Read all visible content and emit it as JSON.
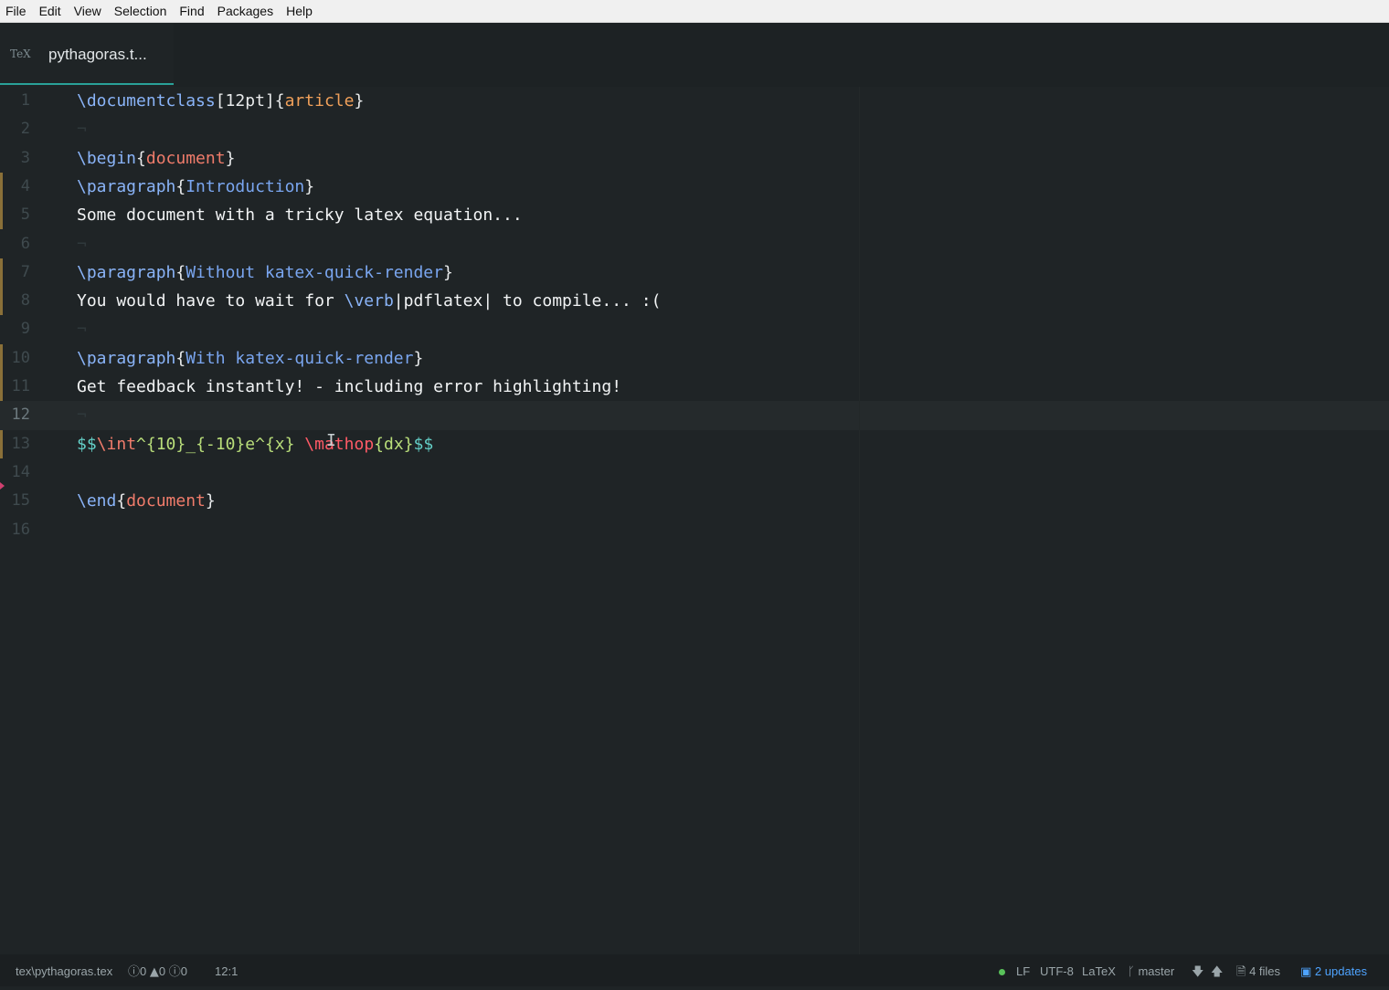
{
  "menu": [
    "File",
    "Edit",
    "View",
    "Selection",
    "Find",
    "Packages",
    "Help"
  ],
  "tab": {
    "icon": "TeX",
    "title": "pythagoras.t..."
  },
  "editor": {
    "line_numbers": [
      "1",
      "2",
      "3",
      "4",
      "5",
      "6",
      "7",
      "8",
      "9",
      "10",
      "11",
      "12",
      "13",
      "14",
      "15",
      "16"
    ],
    "current_line": 12,
    "lines": {
      "l1": {
        "cmd": "\\documentclass",
        "opt": "[12pt]",
        "lb": "{",
        "arg": "article",
        "rb": "}"
      },
      "l3": {
        "cmd": "\\begin",
        "lb": "{",
        "arg": "document",
        "rb": "}"
      },
      "l4": {
        "cmd": "\\paragraph",
        "lb": "{",
        "arg": "Introduction",
        "rb": "}"
      },
      "l5": {
        "text": "Some document with a tricky latex equation..."
      },
      "l7": {
        "cmd": "\\paragraph",
        "lb": "{",
        "arg": "Without katex-quick-render",
        "rb": "}"
      },
      "l8": {
        "text1": "You would have to wait for ",
        "cmd": "\\verb",
        "verb": "|pdflatex|",
        "text2": " to compile... :("
      },
      "l10": {
        "cmd": "\\paragraph",
        "lb": "{",
        "arg": "With katex-quick-render",
        "rb": "}"
      },
      "l11": {
        "text": "Get feedback instantly! - including error highlighting!"
      },
      "l13": {
        "dollar_open": "$$",
        "int": "\\int",
        "sup": "^{10}_{-10}",
        "e": "e^{x}",
        "space": " ",
        "err": "\\mathop",
        "arg": "{dx}",
        "dollar_close": "$$"
      },
      "l15": {
        "cmd": "\\end",
        "lb": "{",
        "arg": "document",
        "rb": "}"
      }
    },
    "invisible_marker": "¬"
  },
  "status": {
    "path": "tex\\pythagoras.tex",
    "errors": "0",
    "warnings": "0",
    "infos": "0",
    "cursor_pos": "12:1",
    "line_ending": "LF",
    "encoding": "UTF-8",
    "grammar": "LaTeX",
    "branch": "master",
    "files": "4 files",
    "updates": "2 updates"
  },
  "colors": {
    "accent": "#2aa198",
    "updates": "#4ea3ff",
    "error": "#ff5a66"
  }
}
